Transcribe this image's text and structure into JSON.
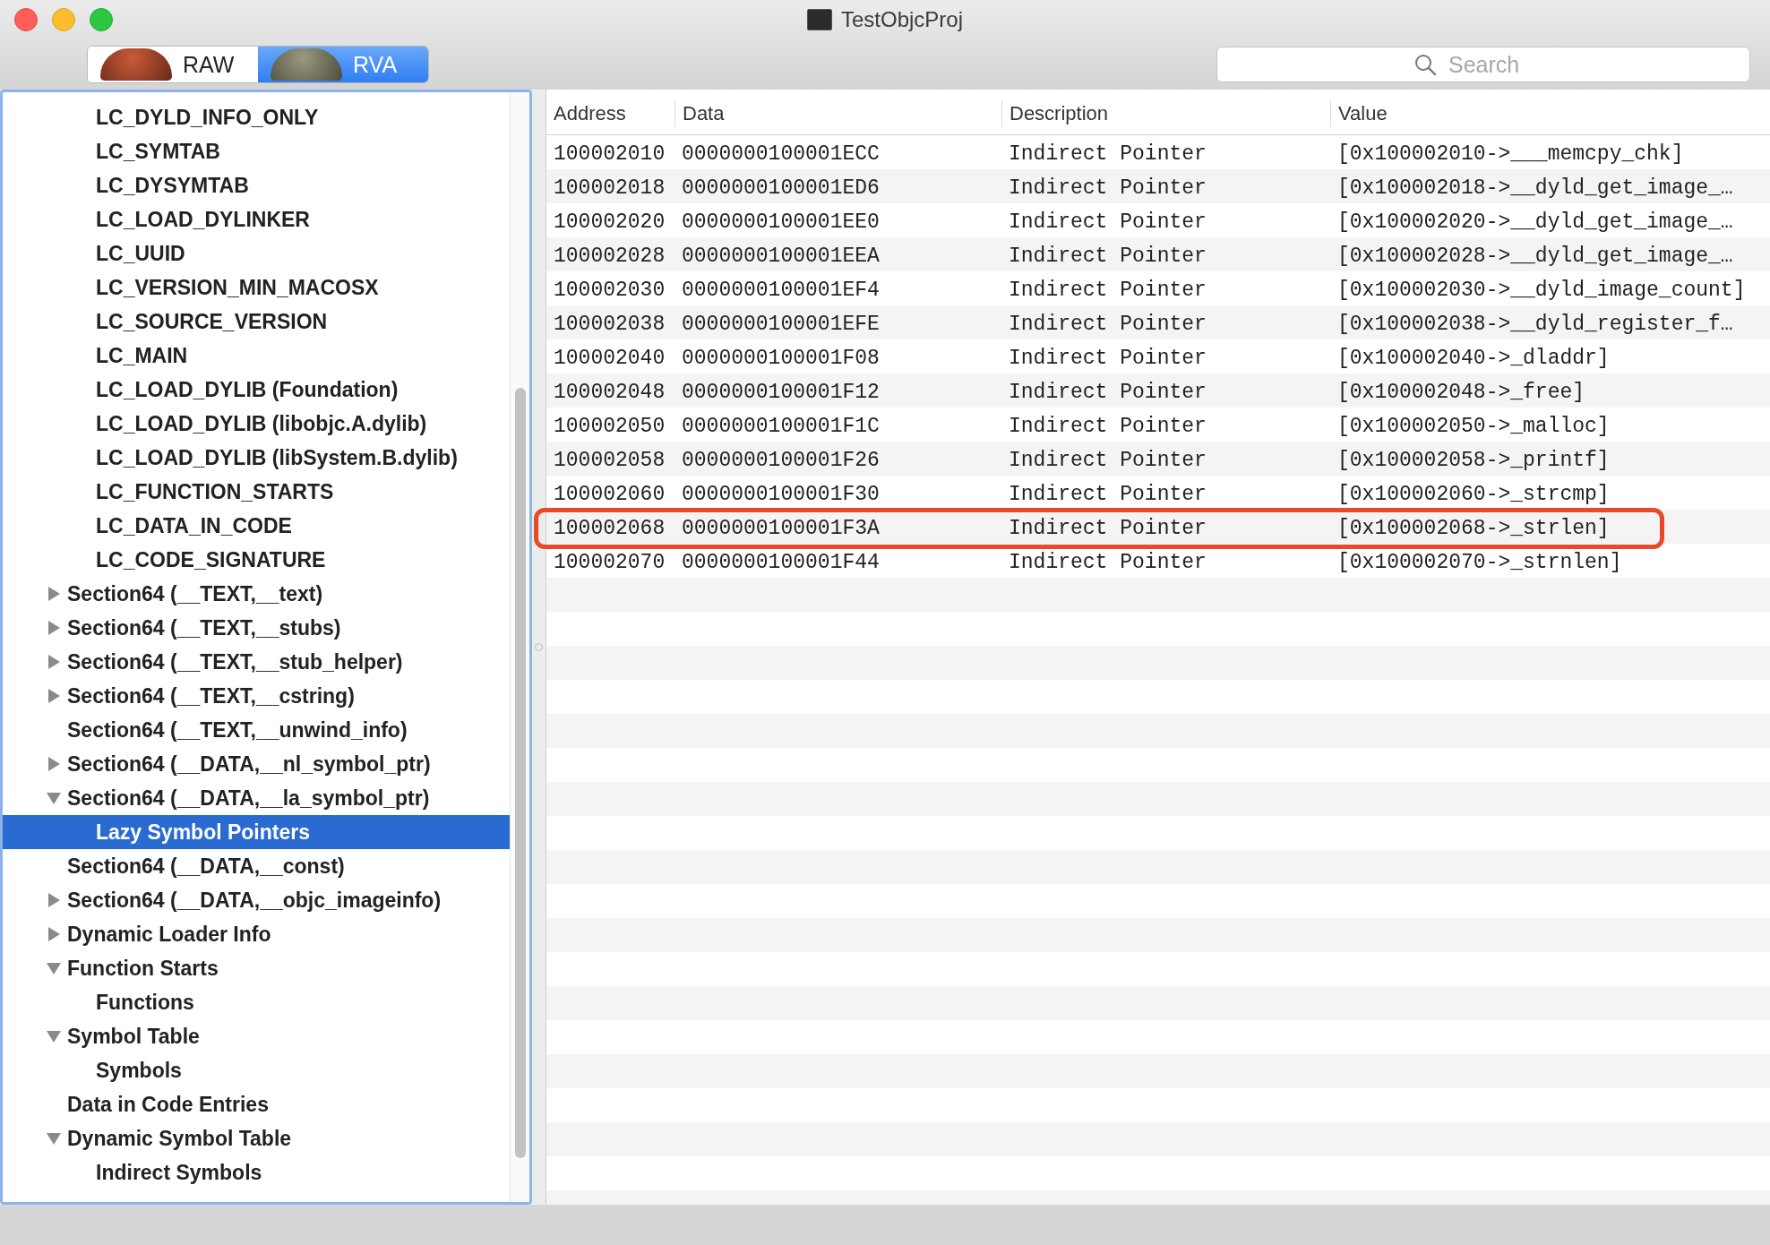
{
  "window": {
    "title": "TestObjcProj"
  },
  "toolbar": {
    "segments": [
      {
        "label": "RAW",
        "selected": false
      },
      {
        "label": "RVA",
        "selected": true
      }
    ],
    "search": {
      "placeholder": "Search"
    }
  },
  "sidebar": {
    "items": [
      {
        "children": [
          {
            "label": "LC_DYLD_INFO_ONLY",
            "selected": false
          },
          {
            "label": "LC_SYMTAB",
            "selected": false
          },
          {
            "label": "LC_DYSYMTAB",
            "selected": false
          },
          {
            "label": "LC_LOAD_DYLINKER",
            "selected": false
          },
          {
            "label": "LC_UUID",
            "selected": false
          },
          {
            "label": "LC_VERSION_MIN_MACOSX",
            "selected": false
          },
          {
            "label": "LC_SOURCE_VERSION",
            "selected": false
          },
          {
            "label": "LC_MAIN",
            "selected": false
          },
          {
            "label": "LC_LOAD_DYLIB (Foundation)",
            "selected": false
          },
          {
            "label": "LC_LOAD_DYLIB (libobjc.A.dylib)",
            "selected": false
          },
          {
            "label": "LC_LOAD_DYLIB (libSystem.B.dylib)",
            "selected": false
          },
          {
            "label": "LC_FUNCTION_STARTS",
            "selected": false
          },
          {
            "label": "LC_DATA_IN_CODE",
            "selected": false
          },
          {
            "label": "LC_CODE_SIGNATURE",
            "selected": false
          }
        ]
      },
      {
        "label": "Section64 (__TEXT,__text)",
        "selected": false,
        "expanded": false
      },
      {
        "label": "Section64 (__TEXT,__stubs)",
        "selected": false,
        "expanded": false
      },
      {
        "label": "Section64 (__TEXT,__stub_helper)",
        "selected": false,
        "expanded": false
      },
      {
        "label": "Section64 (__TEXT,__cstring)",
        "selected": false,
        "expanded": false
      },
      {
        "label": "Section64 (__TEXT,__unwind_info)",
        "selected": false
      },
      {
        "label": "Section64 (__DATA,__nl_symbol_ptr)",
        "selected": false,
        "expanded": false
      },
      {
        "label": "Section64 (__DATA,__la_symbol_ptr)",
        "selected": false,
        "expanded": true,
        "children": [
          {
            "label": "Lazy Symbol Pointers",
            "selected": true
          }
        ]
      },
      {
        "label": "Section64 (__DATA,__const)",
        "selected": false
      },
      {
        "label": "Section64 (__DATA,__objc_imageinfo)",
        "selected": false,
        "expanded": false
      },
      {
        "label": "Dynamic Loader Info",
        "selected": false,
        "expanded": false
      },
      {
        "label": "Function Starts",
        "selected": false,
        "expanded": true,
        "children": [
          {
            "label": "Functions",
            "selected": false
          }
        ]
      },
      {
        "label": "Symbol Table",
        "selected": false,
        "expanded": true,
        "children": [
          {
            "label": "Symbols",
            "selected": false
          }
        ]
      },
      {
        "label": "Data in Code Entries",
        "selected": false
      },
      {
        "label": "Dynamic Symbol Table",
        "selected": false,
        "expanded": true,
        "children": [
          {
            "label": "Indirect Symbols",
            "selected": false
          }
        ]
      }
    ]
  },
  "table": {
    "columns": [
      "Address",
      "Data",
      "Description",
      "Value"
    ],
    "rows": [
      {
        "cells": [
          "100002010",
          "0000000100001ECC",
          "Indirect Pointer",
          "[0x100002010->___memcpy_chk]"
        ],
        "outlined": false
      },
      {
        "cells": [
          "100002018",
          "0000000100001ED6",
          "Indirect Pointer",
          "[0x100002018->__dyld_get_image_…"
        ],
        "outlined": false
      },
      {
        "cells": [
          "100002020",
          "0000000100001EE0",
          "Indirect Pointer",
          "[0x100002020->__dyld_get_image_…"
        ],
        "outlined": false
      },
      {
        "cells": [
          "100002028",
          "0000000100001EEA",
          "Indirect Pointer",
          "[0x100002028->__dyld_get_image_…"
        ],
        "outlined": false
      },
      {
        "cells": [
          "100002030",
          "0000000100001EF4",
          "Indirect Pointer",
          "[0x100002030->__dyld_image_count]"
        ],
        "outlined": false
      },
      {
        "cells": [
          "100002038",
          "0000000100001EFE",
          "Indirect Pointer",
          "[0x100002038->__dyld_register_f…"
        ],
        "outlined": false
      },
      {
        "cells": [
          "100002040",
          "0000000100001F08",
          "Indirect Pointer",
          "[0x100002040->_dladdr]"
        ],
        "outlined": false
      },
      {
        "cells": [
          "100002048",
          "0000000100001F12",
          "Indirect Pointer",
          "[0x100002048->_free]"
        ],
        "outlined": false
      },
      {
        "cells": [
          "100002050",
          "0000000100001F1C",
          "Indirect Pointer",
          "[0x100002050->_malloc]"
        ],
        "outlined": false
      },
      {
        "cells": [
          "100002058",
          "0000000100001F26",
          "Indirect Pointer",
          "[0x100002058->_printf]"
        ],
        "outlined": false
      },
      {
        "cells": [
          "100002060",
          "0000000100001F30",
          "Indirect Pointer",
          "[0x100002060->_strcmp]"
        ],
        "outlined": false
      },
      {
        "cells": [
          "100002068",
          "0000000100001F3A",
          "Indirect Pointer",
          "[0x100002068->_strlen]"
        ],
        "outlined": true
      },
      {
        "cells": [
          "100002070",
          "0000000100001F44",
          "Indirect Pointer",
          "[0x100002070->_strnlen]"
        ],
        "outlined": false
      }
    ]
  }
}
